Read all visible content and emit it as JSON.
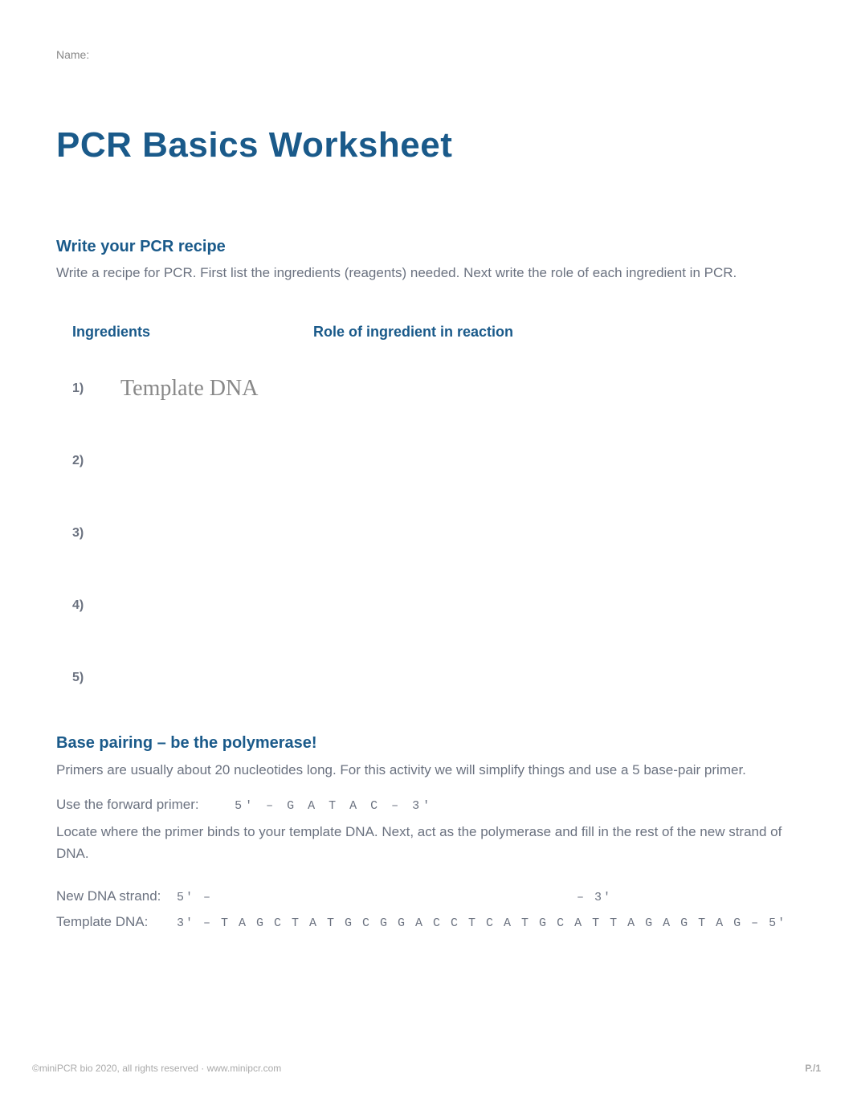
{
  "name_label": "Name:",
  "main_title": "PCR Basics Worksheet",
  "section1": {
    "heading": "Write your PCR recipe",
    "description": "Write a recipe for PCR. First list the ingredients (reagents) needed. Next write the role of each ingredient in PCR.",
    "col_ingredients": "Ingredients",
    "col_role": "Role of ingredient in reaction",
    "rows": [
      {
        "num": "1)",
        "ingredient": "Template DNA"
      },
      {
        "num": "2)",
        "ingredient": ""
      },
      {
        "num": "3)",
        "ingredient": ""
      },
      {
        "num": "4)",
        "ingredient": ""
      },
      {
        "num": "5)",
        "ingredient": ""
      }
    ]
  },
  "section2": {
    "heading": "Base pairing – be the polymerase!",
    "description": "Primers are usually about 20 nucleotides long. For this activity we will simplify things and use a 5 base-pair primer.",
    "forward_primer_label": "Use the forward primer:",
    "forward_primer_seq": "5' – G A T A C – 3'",
    "instruction": "Locate where the primer binds to your template DNA. Next, act as the polymerase and fill in the rest of the new strand of DNA.",
    "new_strand_label": "New DNA strand:",
    "new_strand_start": "5'  –",
    "new_strand_end": "– 3'",
    "template_label": "Template DNA:",
    "template_seq": "3' – T A G C T A T G C G G A C C T C A T G C A T T A G A G T A G – 5'"
  },
  "footer": {
    "copyright": "©miniPCR bio 2020, all rights reserved · www.minipcr.com",
    "page": "P./1"
  }
}
